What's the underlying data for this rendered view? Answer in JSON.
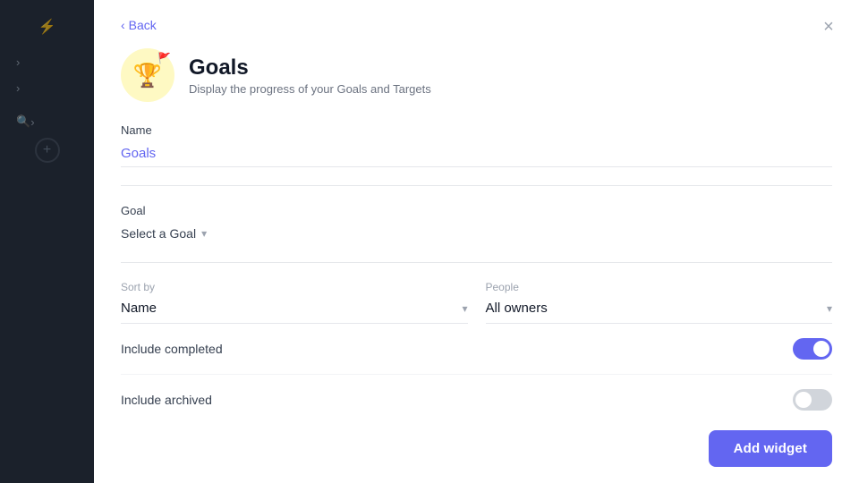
{
  "sidebar": {
    "icons": [
      {
        "name": "bolt-icon",
        "symbol": "⚡"
      },
      {
        "name": "chevron-right-icon-1",
        "symbol": "›"
      },
      {
        "name": "chevron-right-icon-2",
        "symbol": "›"
      },
      {
        "name": "search-icon",
        "symbol": "🔍"
      },
      {
        "name": "plus-icon",
        "symbol": "+"
      }
    ]
  },
  "modal": {
    "back_label": "Back",
    "close_label": "×",
    "title": "Goals",
    "subtitle": "Display the progress of your Goals and Targets",
    "icon": "🏆",
    "flag": "🚩"
  },
  "form": {
    "name_label": "Name",
    "name_value": "Goals",
    "goal_label": "Goal",
    "goal_placeholder": "Select a Goal",
    "sort_label": "Sort by",
    "sort_value": "Name",
    "people_label": "People",
    "people_value": "All owners",
    "include_completed_label": "Include completed",
    "include_completed_on": true,
    "include_archived_label": "Include archived",
    "include_archived_on": false
  },
  "footer": {
    "add_widget_label": "Add widget"
  }
}
